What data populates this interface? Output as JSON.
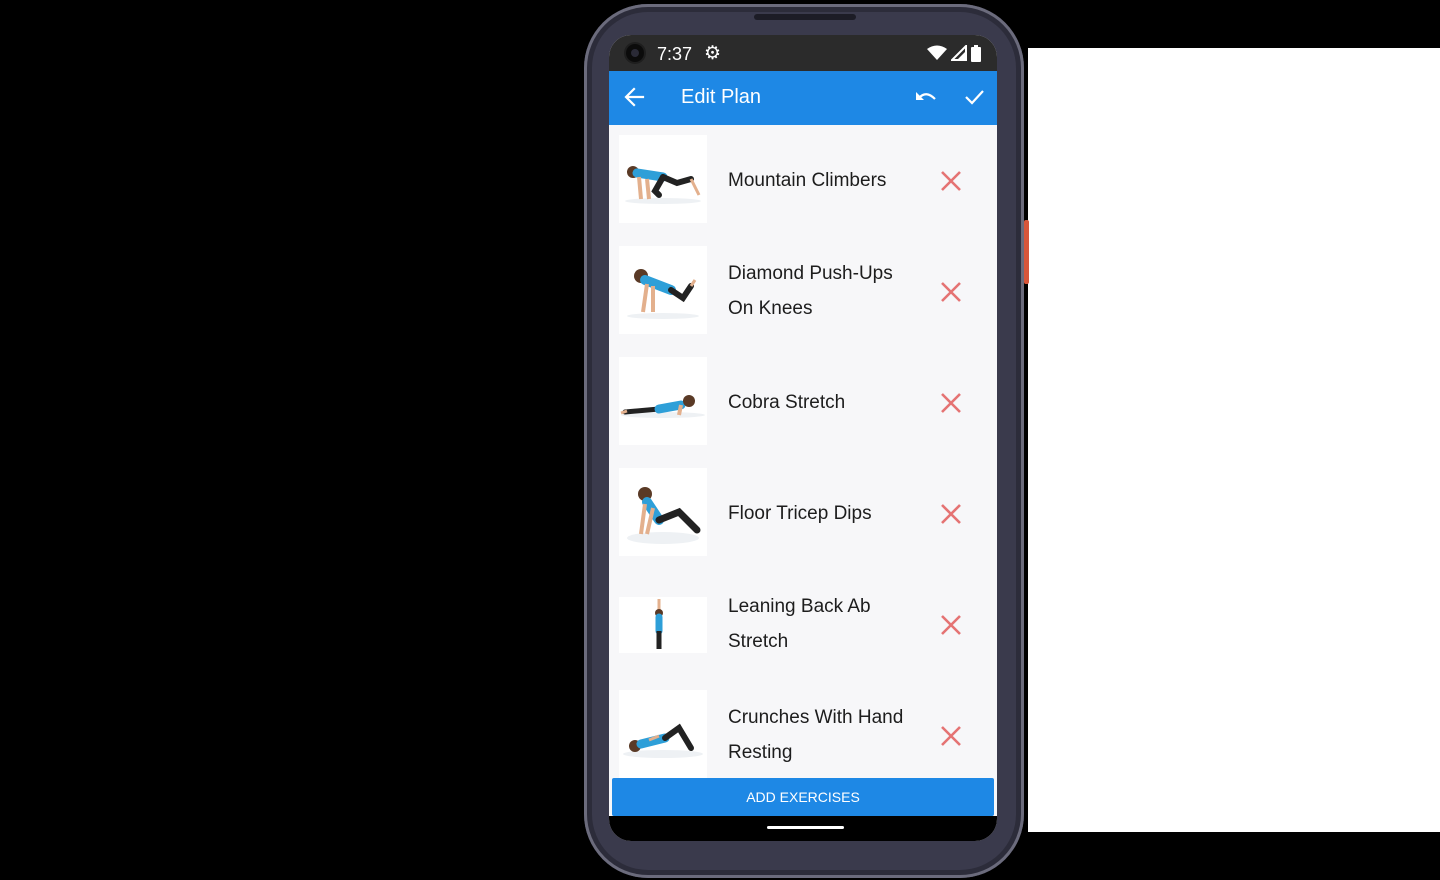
{
  "status_bar": {
    "time": "7:37",
    "icons": [
      "gear-icon",
      "wifi-icon",
      "signal-icon",
      "battery-icon"
    ]
  },
  "app_bar": {
    "title": "Edit Plan",
    "icons": [
      "back-arrow-icon",
      "undo-icon",
      "check-icon"
    ]
  },
  "exercises": [
    {
      "name": "Mountain Climbers",
      "pose": "mountain-climber"
    },
    {
      "name": "Diamond Push-Ups On Knees",
      "pose": "pushup-knees"
    },
    {
      "name": "Cobra Stretch",
      "pose": "lying"
    },
    {
      "name": "Floor Tricep Dips",
      "pose": "tricep-dip"
    },
    {
      "name": "Leaning Back Ab Stretch",
      "pose": "standing"
    },
    {
      "name": "Crunches With Hand Resting",
      "pose": "crunch"
    }
  ],
  "footer": {
    "add_button": "ADD EXERCISES"
  },
  "colors": {
    "accent": "#1e88e5",
    "remove": "#e57373",
    "status_bar": "#2b2b2b"
  }
}
